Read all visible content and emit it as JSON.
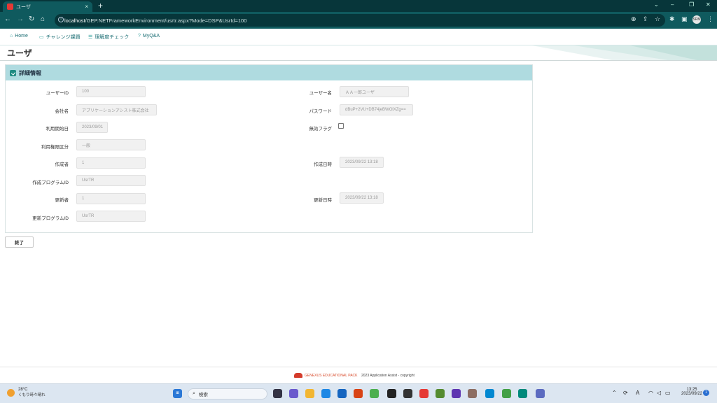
{
  "browser": {
    "tab_title": "ユーザ",
    "tab_close": "×",
    "new_tab": "+",
    "url_host": "localhost",
    "url_path": "/GEP.NETFrameworkEnvironment/usrtr.aspx?Mode=DSP&UsrId=100",
    "profile": "SRM",
    "window_minimize": "–",
    "window_restore": "❐",
    "window_close": "✕",
    "window_chevron": "⌄"
  },
  "appnav": {
    "home": "Home",
    "challenge": "チャレンジ課題",
    "understanding": "理解度チェック",
    "qa": "MyQ&A"
  },
  "page": {
    "title": "ユーザ"
  },
  "panel": {
    "title": "詳細情報",
    "fields": {
      "user_id_label": "ユーザーID",
      "user_id_value": "100",
      "user_name_label": "ユーザー名",
      "user_name_value": "ＡＡ一郎ユーザ",
      "company_label": "会社名",
      "company_value": "アプリケーションアシスト株式会社",
      "password_label": "パスワード",
      "password_value": "dBuP+2VU+DB74jeBWOlXZg==",
      "start_date_label": "利用開始日",
      "start_date_value": "2023/09/01",
      "invalid_flag_label": "無効フラグ",
      "permission_label": "利用権限区分",
      "permission_value": "一般",
      "creator_label": "作成者",
      "creator_value": "1",
      "created_at_label": "作成日時",
      "created_at_value": "2023/09/22 13:18",
      "create_program_label": "作成プログラムID",
      "create_program_value": "UsrTR",
      "updater_label": "更新者",
      "updater_value": "1",
      "updated_at_label": "更新日時",
      "updated_at_value": "2023/09/22 13:18",
      "update_program_label": "更新プログラムID",
      "update_program_value": "UsrTR"
    }
  },
  "buttons": {
    "close": "終了"
  },
  "footer": {
    "logo_text": "GENEXUS EDUCATIONAL PACK",
    "copyright": "2023 Application Assist - copyright"
  },
  "taskbar": {
    "weather_temp": "28°C",
    "weather_desc": "くもり時々晴れ",
    "search_placeholder": "検索",
    "ime": "A",
    "time": "13:25",
    "date": "2023/09/22",
    "notification_count": "1"
  },
  "colors": {
    "chrome_dark": "#07363a",
    "chrome": "#0f5a5e",
    "panel_header": "#afdbe0",
    "accent": "#1f8b82"
  }
}
